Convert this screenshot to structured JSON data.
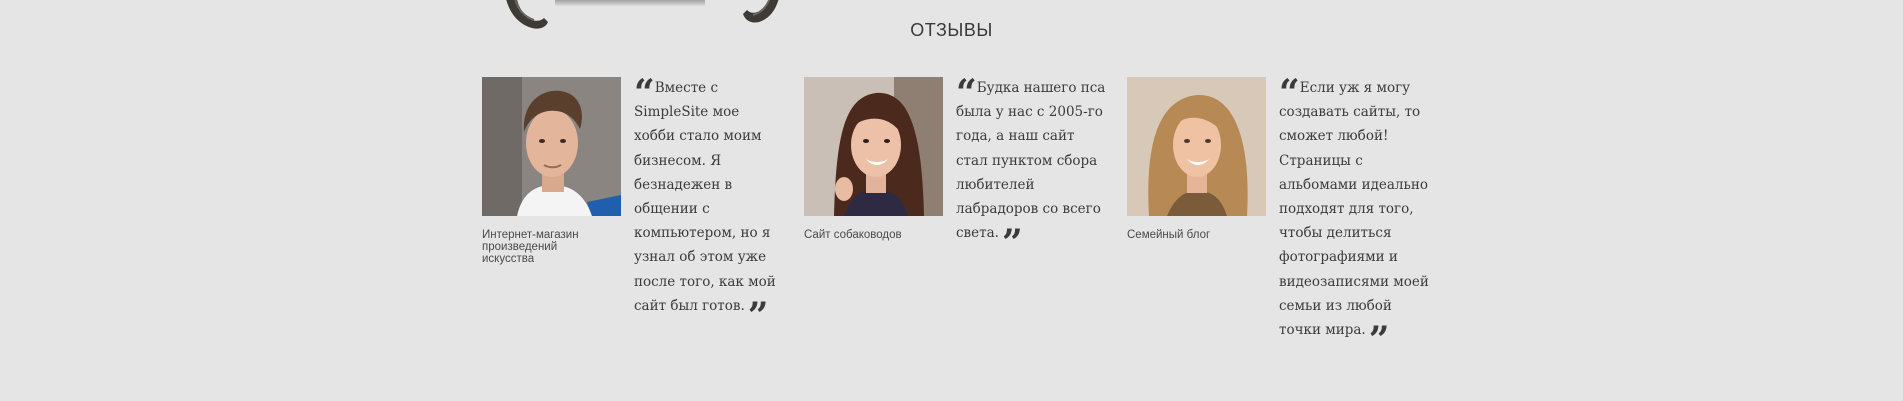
{
  "section": {
    "title": "ОТЗЫВЫ"
  },
  "quote_marks": {
    "open": "“",
    "close": "”"
  },
  "testimonials": [
    {
      "caption": "Интернет-магазин произведений искусства",
      "text": "Вместе с SimpleSite мое хобби стало моим бизнесом. Я безнадежен в общении с компьютером, но я узнал об этом уже после того, как мой сайт был готов."
    },
    {
      "caption": "Сайт собаководов",
      "text": "Будка нашего пса была у нас с 2005-го года, а наш сайт стал пунктом сбора любителей лабрадоров со всего света."
    },
    {
      "caption": "Семейный блог",
      "text": "Если уж я могу создавать сайты, то сможет любой! Страницы с альбомами идеально подходят для того, чтобы делиться фотографиями и видеозаписями моей семьи из любой точки мира."
    }
  ]
}
